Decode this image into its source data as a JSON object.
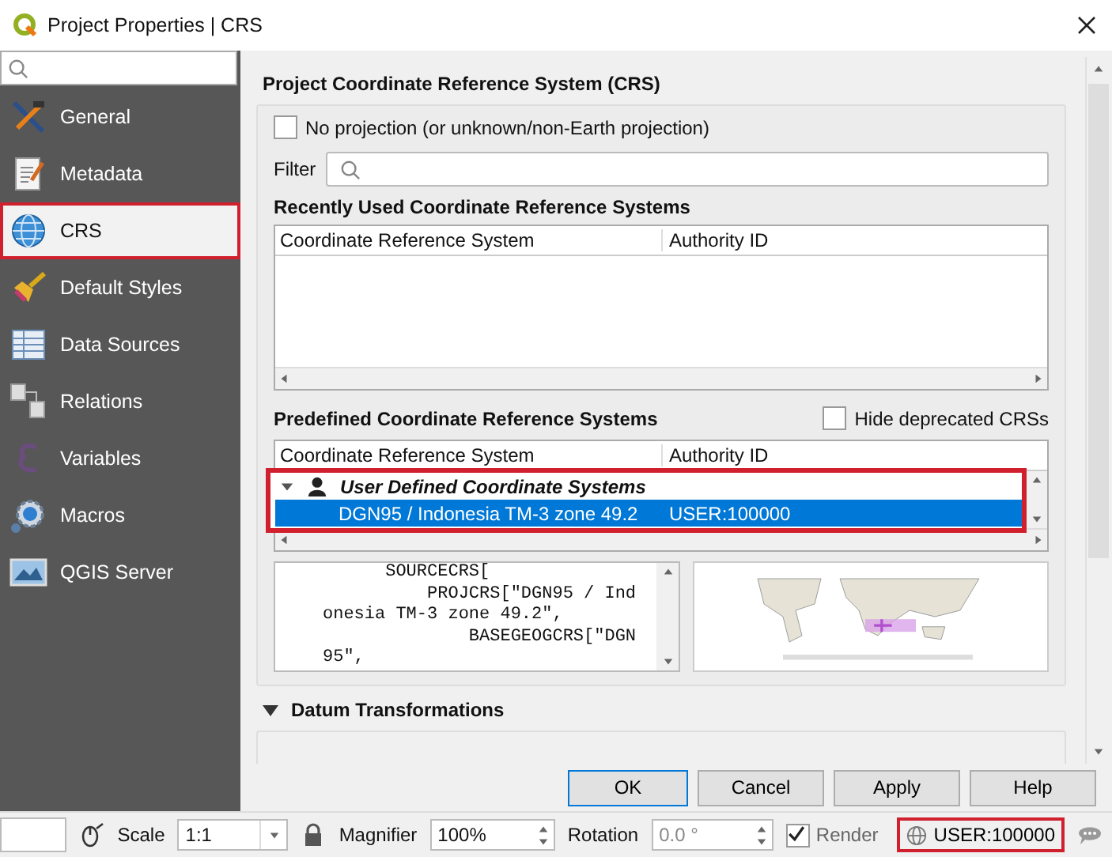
{
  "window": {
    "title": "Project Properties | CRS"
  },
  "sidebar": {
    "items": [
      {
        "label": "General",
        "selected": false
      },
      {
        "label": "Metadata",
        "selected": false
      },
      {
        "label": "CRS",
        "selected": true
      },
      {
        "label": "Default Styles",
        "selected": false
      },
      {
        "label": "Data Sources",
        "selected": false
      },
      {
        "label": "Relations",
        "selected": false
      },
      {
        "label": "Variables",
        "selected": false
      },
      {
        "label": "Macros",
        "selected": false
      },
      {
        "label": "QGIS Server",
        "selected": false
      }
    ]
  },
  "crs": {
    "heading": "Project Coordinate Reference System (CRS)",
    "no_projection": {
      "label": "No projection (or unknown/non-Earth projection)",
      "checked": false
    },
    "filter_label": "Filter",
    "recent": {
      "heading": "Recently Used Coordinate Reference Systems",
      "columns": [
        "Coordinate Reference System",
        "Authority ID"
      ]
    },
    "predefined": {
      "heading": "Predefined Coordinate Reference Systems",
      "hide_deprecated": {
        "label": "Hide deprecated CRSs",
        "checked": false
      },
      "columns": [
        "Coordinate Reference System",
        "Authority ID"
      ],
      "groups": [
        {
          "label": "User Defined Coordinate Systems",
          "expanded": true,
          "children": [
            {
              "name": "DGN95 / Indonesia TM-3 zone 49.2",
              "authority": "USER:100000",
              "selected": true
            }
          ]
        }
      ]
    },
    "wkt_lines": [
      "      SOURCECRS[",
      "          PROJCRS[\"DGN95 / Ind",
      "onesia TM-3 zone 49.2\",",
      "              BASEGEOGCRS[\"DGN",
      "95\","
    ]
  },
  "datum": {
    "heading": "Datum Transformations",
    "expanded": true
  },
  "buttons": [
    "OK",
    "Cancel",
    "Apply",
    "Help"
  ],
  "status_bar": {
    "scale_label": "Scale",
    "scale": "1:1",
    "magnifier_label": "Magnifier",
    "magnifier": "100%",
    "rotation_label": "Rotation",
    "rotation": "0.0 °",
    "render": {
      "label": "Render",
      "checked": true
    },
    "crs": "USER:100000"
  }
}
